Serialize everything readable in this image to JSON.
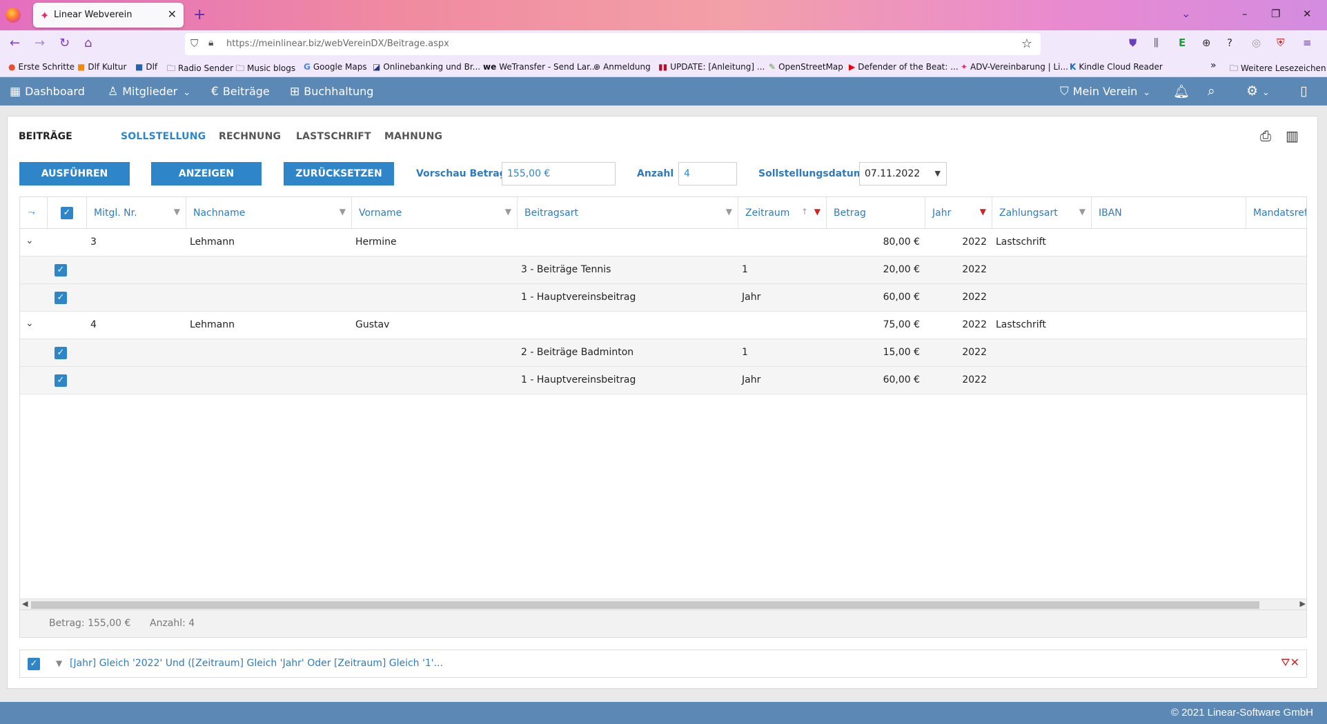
{
  "browser": {
    "tab_title": "Linear Webverein",
    "url": "https://meinlinear.biz/webVereinDX/Beitrage.aspx",
    "bookmarks": [
      "Erste Schritte",
      "Dlf Kultur",
      "Dlf",
      "Radio Sender",
      "Music blogs",
      "Google Maps",
      "Onlinebanking und Br...",
      "WeTransfer - Send Lar...",
      "Anmeldung",
      "UPDATE: [Anleitung] ...",
      "OpenStreetMap",
      "Defender of the Beat: ...",
      "ADV-Vereinbarung | Li...",
      "Kindle Cloud Reader",
      "Weitere Lesezeichen"
    ]
  },
  "app_nav": {
    "dashboard": "Dashboard",
    "mitglieder": "Mitglieder",
    "beitraege": "Beiträge",
    "buchhaltung": "Buchhaltung",
    "verein": "Mein Verein"
  },
  "page": {
    "title": "BEITRÄGE",
    "tabs": [
      "SOLLSTELLUNG",
      "RECHNUNG",
      "LASTSCHRIFT",
      "MAHNUNG"
    ],
    "active_tab": "SOLLSTELLUNG"
  },
  "toolbar": {
    "execute": "AUSFÜHREN",
    "show": "ANZEIGEN",
    "reset": "ZURÜCKSETZEN",
    "preview_label": "Vorschau Betrag",
    "preview_value": "155,00 €",
    "count_label": "Anzahl",
    "count_value": "4",
    "date_label": "Sollstellungsdatum",
    "date_value": "07.11.2022"
  },
  "grid": {
    "columns": [
      "Mitgl. Nr.",
      "Nachname",
      "Vorname",
      "Beitragsart",
      "Zeitraum",
      "Betrag",
      "Jahr",
      "Zahlungsart",
      "IBAN",
      "Mandatsrefe"
    ],
    "rows": [
      {
        "type": "group",
        "nr": "3",
        "nachname": "Lehmann",
        "vorname": "Hermine",
        "betrag": "80,00 €",
        "jahr": "2022",
        "zahlungsart": "Lastschrift"
      },
      {
        "type": "child",
        "beitragsart": "3 - Beiträge Tennis",
        "zeitraum": "1",
        "betrag": "20,00 €",
        "jahr": "2022"
      },
      {
        "type": "child",
        "beitragsart": "1 - Hauptvereinsbeitrag",
        "zeitraum": "Jahr",
        "betrag": "60,00 €",
        "jahr": "2022"
      },
      {
        "type": "group",
        "nr": "4",
        "nachname": "Lehmann",
        "vorname": "Gustav",
        "betrag": "75,00 €",
        "jahr": "2022",
        "zahlungsart": "Lastschrift"
      },
      {
        "type": "child",
        "beitragsart": "2 - Beiträge Badminton",
        "zeitraum": "1",
        "betrag": "15,00 €",
        "jahr": "2022"
      },
      {
        "type": "child",
        "beitragsart": "1 - Hauptvereinsbeitrag",
        "zeitraum": "Jahr",
        "betrag": "60,00 €",
        "jahr": "2022"
      }
    ],
    "summary_betrag": "Betrag: 155,00 €",
    "summary_anzahl": "Anzahl: 4"
  },
  "filter": {
    "text": "[Jahr] Gleich '2022' Und ([Zeitraum] Gleich 'Jahr' Oder [Zeitraum] Gleich '1'..."
  },
  "footer": {
    "copyright": "© 2021 Linear-Software GmbH"
  },
  "colors": {
    "accent": "#2e86c9",
    "header": "#5b88b5",
    "filter_active": "#d42020"
  }
}
